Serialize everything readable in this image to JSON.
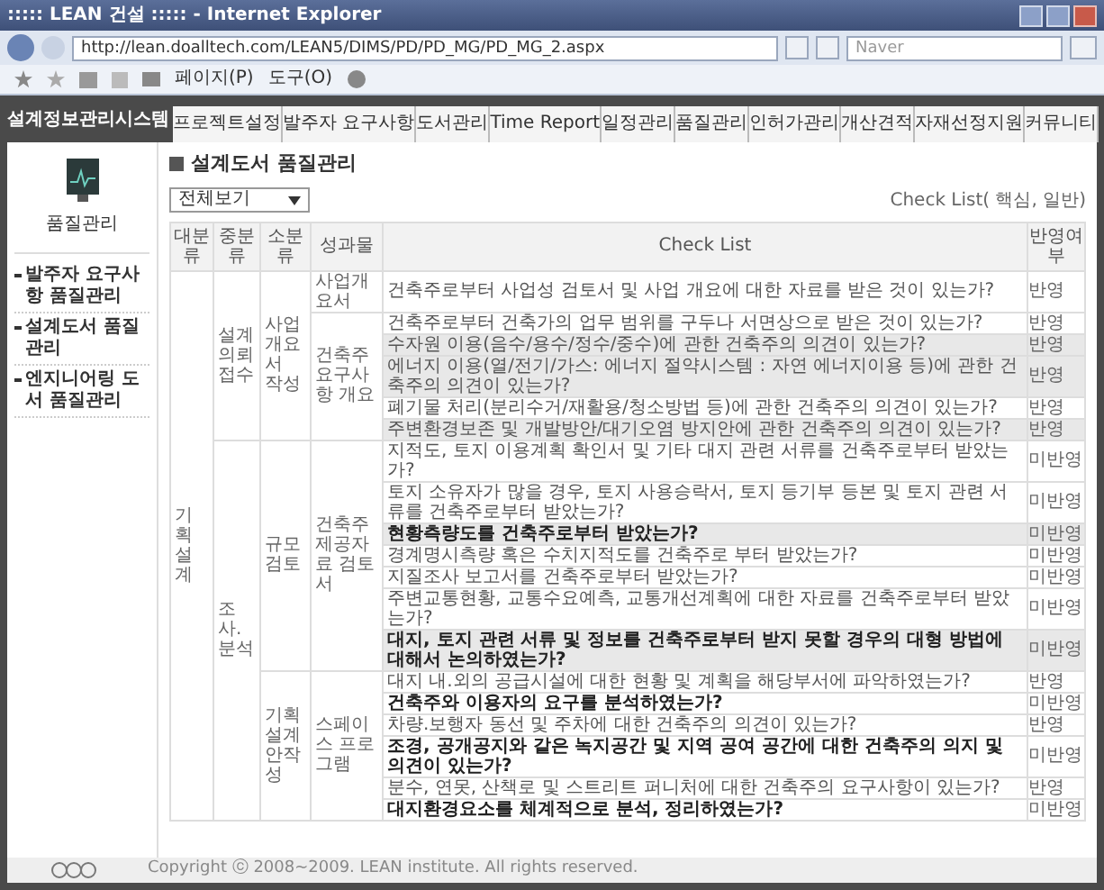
{
  "window": {
    "title": "::::: LEAN 건설 ::::: - Internet Explorer"
  },
  "address_bar": {
    "url": "http://lean.doalltech.com/LEAN5/DIMS/PD/PD_MG/PD_MG_2.aspx",
    "search_placeholder": "Naver"
  },
  "toolbar": {
    "items": [
      "페이지(P)",
      "도구(O)"
    ]
  },
  "site": {
    "logo": "설계정보관리시스템",
    "tabs": [
      "프로젝트설정",
      "발주자 요구사항",
      "도서관리",
      "Time Report",
      "일정관리",
      "품질관리",
      "인허가관리",
      "개산견적",
      "자재선정지원",
      "커뮤니티"
    ]
  },
  "sidebar": {
    "title": "품질관리",
    "items": [
      "발주자 요구사항 품질관리",
      "설계도서 품질관리",
      "엔지니어링 도서 품질관리"
    ]
  },
  "content": {
    "title": "설계도서 품질관리",
    "filter": "전체보기",
    "legend": "Check List( 핵심, 일반)"
  },
  "table": {
    "columns": [
      "대분류",
      "중분류",
      "소분류",
      "성과물",
      "Check List",
      "반영여부"
    ],
    "groups": [
      {
        "label": "기획설계",
        "children": [
          {
            "label": "설계의뢰 접수",
            "children": [
              {
                "label": "사업개요서 작성",
                "children": [
                  {
                    "label": "사업개요서",
                    "rows": [
                      {
                        "check": "건축주로부터 사업성 검토서 및 사업 개요에 대한 자료를 받은 것이 있는가?",
                        "status": "반영",
                        "shaded": false,
                        "bold": false
                      }
                    ]
                  },
                  {
                    "label": "건축주 요구사항 개요",
                    "rows": [
                      {
                        "check": "건축주로부터 건축가의 업무 범위를 구두나 서면상으로 받은 것이 있는가?",
                        "status": "반영",
                        "shaded": false,
                        "bold": false
                      },
                      {
                        "check": "수자원 이용(음수/용수/정수/중수)에 관한 건축주의 의견이 있는가?",
                        "status": "반영",
                        "shaded": true,
                        "bold": false
                      },
                      {
                        "check": "에너지 이용(열/전기/가스: 에너지 절약시스템 : 자연 에너지이용 등)에 관한 건축주의 의견이 있는가?",
                        "status": "반영",
                        "shaded": true,
                        "bold": false
                      },
                      {
                        "check": "폐기물 처리(분리수거/재활용/청소방법 등)에 관한 건축주의 의견이 있는가?",
                        "status": "반영",
                        "shaded": false,
                        "bold": false
                      },
                      {
                        "check": "주변환경보존 및 개발방안/대기오염 방지안에 관한 건축주의 의견이 있는가?",
                        "status": "반영",
                        "shaded": true,
                        "bold": false
                      }
                    ]
                  }
                ]
              }
            ]
          },
          {
            "label": "조사.분석",
            "children": [
              {
                "label": "규모검토",
                "children": [
                  {
                    "label": "건축주 제공자료 검토서",
                    "rows": [
                      {
                        "check": "지적도, 토지 이용계획 확인서 및 기타 대지 관련 서류를 건축주로부터 받았는가?",
                        "status": "미반영",
                        "shaded": false,
                        "bold": false
                      },
                      {
                        "check": "토지 소유자가 많을 경우, 토지 사용승락서, 토지 등기부 등본 및 토지 관련 서류를 건축주로부터 받았는가?",
                        "status": "미반영",
                        "shaded": false,
                        "bold": false
                      },
                      {
                        "check": "현황측량도를 건축주로부터 받았는가?",
                        "status": "미반영",
                        "shaded": true,
                        "bold": true
                      },
                      {
                        "check": "경계명시측량 혹은 수치지적도를 건축주로 부터 받았는가?",
                        "status": "미반영",
                        "shaded": false,
                        "bold": false
                      },
                      {
                        "check": "지질조사 보고서를 건축주로부터 받았는가?",
                        "status": "미반영",
                        "shaded": false,
                        "bold": false
                      },
                      {
                        "check": "주변교통현황, 교통수요예측, 교통개선계획에 대한 자료를 건축주로부터 받았는가?",
                        "status": "미반영",
                        "shaded": false,
                        "bold": false
                      },
                      {
                        "check": "대지, 토지 관련 서류 및 정보를 건축주로부터 받지 못할 경우의 대형 방법에 대해서 논의하였는가?",
                        "status": "미반영",
                        "shaded": true,
                        "bold": true
                      }
                    ]
                  }
                ]
              },
              {
                "label": "기획설계 안작성",
                "children": [
                  {
                    "label": "스페이스 프로그램",
                    "rows": [
                      {
                        "check": "대지 내.외의 공급시설에 대한 현황 및 계획을 해당부서에 파악하였는가?",
                        "status": "반영",
                        "shaded": false,
                        "bold": false
                      },
                      {
                        "check": "건축주와 이용자의 요구를 분석하였는가?",
                        "status": "미반영",
                        "shaded": false,
                        "bold": true
                      },
                      {
                        "check": "차량.보행자 동선 및 주차에 대한 건축주의 의견이 있는가?",
                        "status": "반영",
                        "shaded": false,
                        "bold": false
                      },
                      {
                        "check": "조경, 공개공지와 같은 녹지공간 및 지역 공여 공간에 대한 건축주의 의지 및 의견이 있는가?",
                        "status": "미반영",
                        "shaded": false,
                        "bold": true
                      },
                      {
                        "check": "분수, 연못, 산책로 및 스트리트 퍼니처에 대한 건축주의 요구사항이 있는가?",
                        "status": "반영",
                        "shaded": false,
                        "bold": false
                      },
                      {
                        "check": "대지환경요소를 체계적으로 분석, 정리하였는가?",
                        "status": "미반영",
                        "shaded": false,
                        "bold": true
                      }
                    ]
                  }
                ]
              }
            ]
          }
        ]
      }
    ]
  },
  "footer": {
    "copyright": "Copyright ⓒ 2008~2009. LEAN institute. All rights reserved."
  }
}
